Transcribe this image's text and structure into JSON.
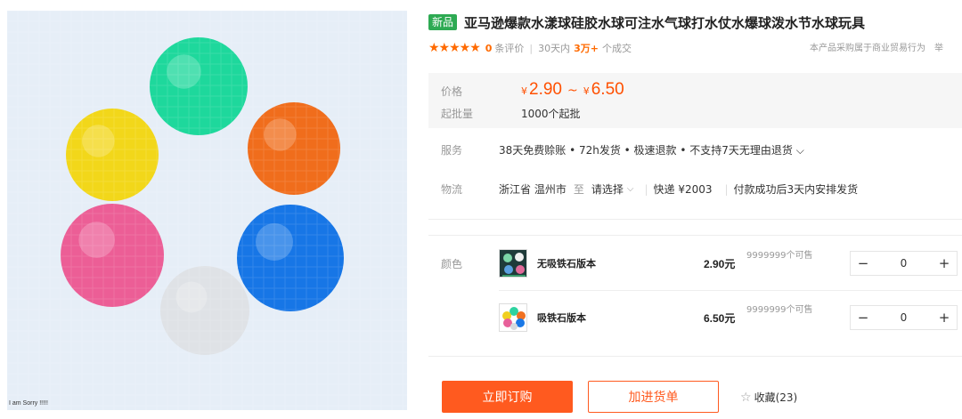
{
  "image": {
    "caption": "I am Sorry !!!!!",
    "ball_colors": {
      "green": "#1ed89c",
      "orange": "#f06d1c",
      "yellow": "#f2d71a",
      "pink": "#ec5e96",
      "blue": "#1776e6",
      "white": "#dfe2e6"
    }
  },
  "product": {
    "badge": "新品",
    "title": "亚马逊爆款水漾球硅胶水球可注水气球打水仗水爆球泼水节水球玩具"
  },
  "rating": {
    "stars": "★★★★★",
    "count": "0",
    "count_label": "条评价",
    "period": "30天内",
    "deals": "3万+",
    "deals_label": "个成交",
    "note": "本产品采购属于商业贸易行为",
    "note_tail": "举"
  },
  "price": {
    "label": "价格",
    "yen": "¥",
    "min": "2.90",
    "tilde": "~",
    "max": "6.50",
    "moq_label": "起批量",
    "moq_value": "1000个起批"
  },
  "service": {
    "label": "服务",
    "text": "38天免费赊账 • 72h发货 • 极速退款 • 不支持7天无理由退货 ⌵"
  },
  "logistics": {
    "label": "物流",
    "origin": "浙江省 温州市",
    "to": "至",
    "destination": "请选择",
    "chevron": "⌵",
    "express": "快递 ¥2003",
    "dispatch": "付款成功后3天内安排发货"
  },
  "sku": {
    "label": "颜色",
    "items": [
      {
        "name": "无吸铁石版本",
        "price": "2.90元",
        "stock": "9999999个可售",
        "qty": "0",
        "minus": "−",
        "plus": "+"
      },
      {
        "name": "吸铁石版本",
        "price": "6.50元",
        "stock": "9999999个可售",
        "qty": "0",
        "minus": "−",
        "plus": "+"
      }
    ]
  },
  "actions": {
    "buy": "立即订购",
    "cart": "加进货单",
    "favorite_icon": "☆",
    "favorite": "收藏(23)"
  }
}
